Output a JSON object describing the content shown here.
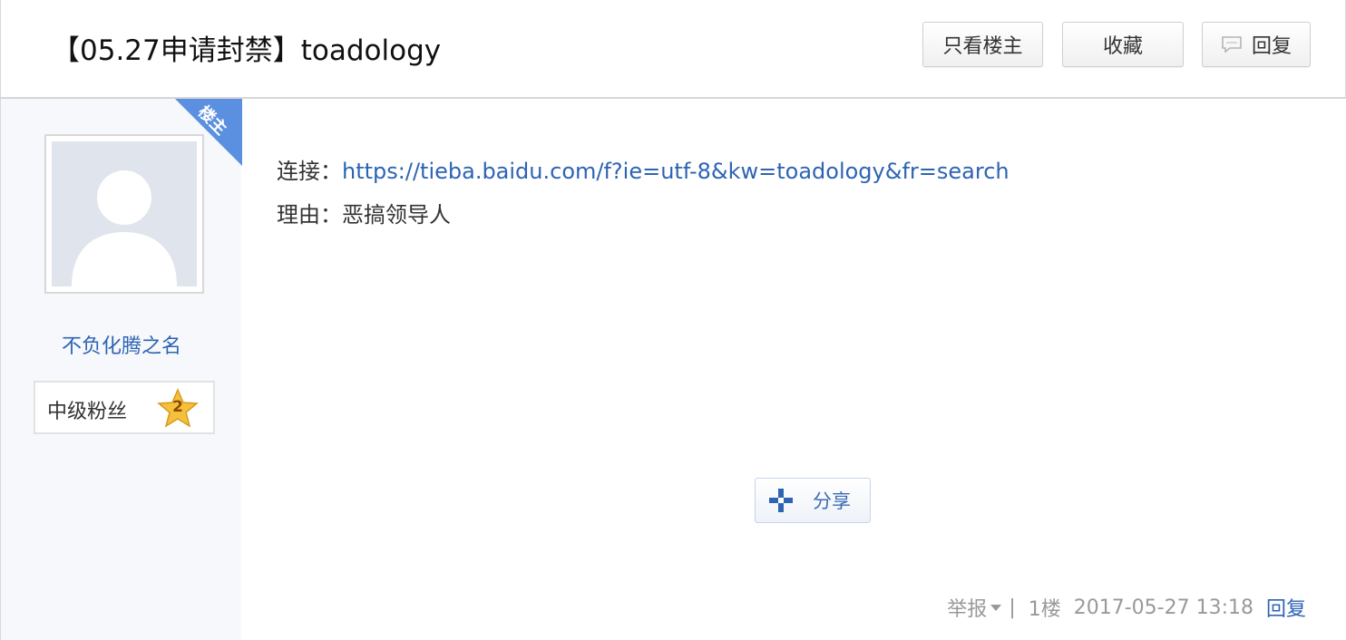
{
  "thread": {
    "title": "【05.27申请封禁】toadology"
  },
  "header_buttons": {
    "only_author": "只看楼主",
    "favorite": "收藏",
    "reply": "回复"
  },
  "author": {
    "badge": "楼主",
    "name": "不负化腾之名",
    "level_title": "中级粉丝",
    "level": "2"
  },
  "post": {
    "link_label": "连接：",
    "link_url": "https://tieba.baidu.com/f?ie=utf-8&kw=toadology&fr=search",
    "reason_label": "理由：",
    "reason_text": "恶搞领导人",
    "share_label": "分享"
  },
  "footer": {
    "report": "举报",
    "separator": "|",
    "floor": "1楼",
    "timestamp": "2017-05-27 13:18",
    "reply": "回复"
  },
  "colors": {
    "link": "#2d64b3",
    "badge": "#5b8fe0",
    "star": "#f5c13a"
  }
}
